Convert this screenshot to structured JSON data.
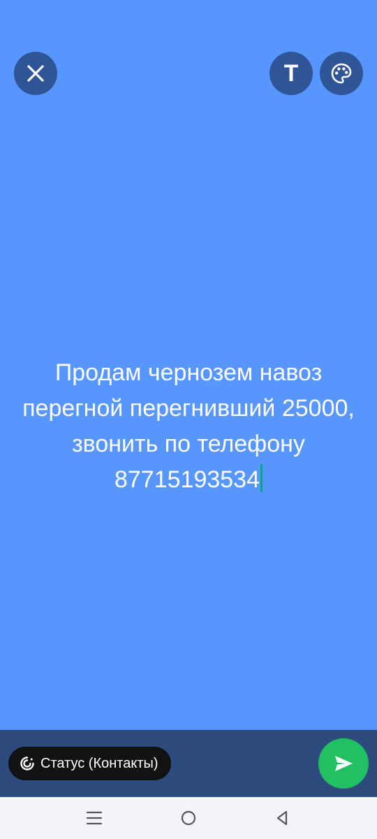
{
  "header": {
    "close_icon": "close-icon",
    "text_style_icon": "text-format-icon",
    "text_style_glyph": "T",
    "palette_icon": "palette-icon"
  },
  "status": {
    "text": "Продам чернозем навоз перегной перегнивший 25000, звонить по телефону 87715193534",
    "background_color": "#5796fd",
    "text_color": "#ffffff",
    "caret_color": "#00a884"
  },
  "footer": {
    "audience_icon": "status-ring-icon",
    "audience_label": "Статус (Контакты)",
    "send_icon": "send-icon",
    "send_color": "#21c063",
    "bar_color": "#2d4b7d"
  },
  "navigation": {
    "recents_icon": "menu-icon",
    "home_icon": "home-circle-icon",
    "back_icon": "back-triangle-icon"
  }
}
